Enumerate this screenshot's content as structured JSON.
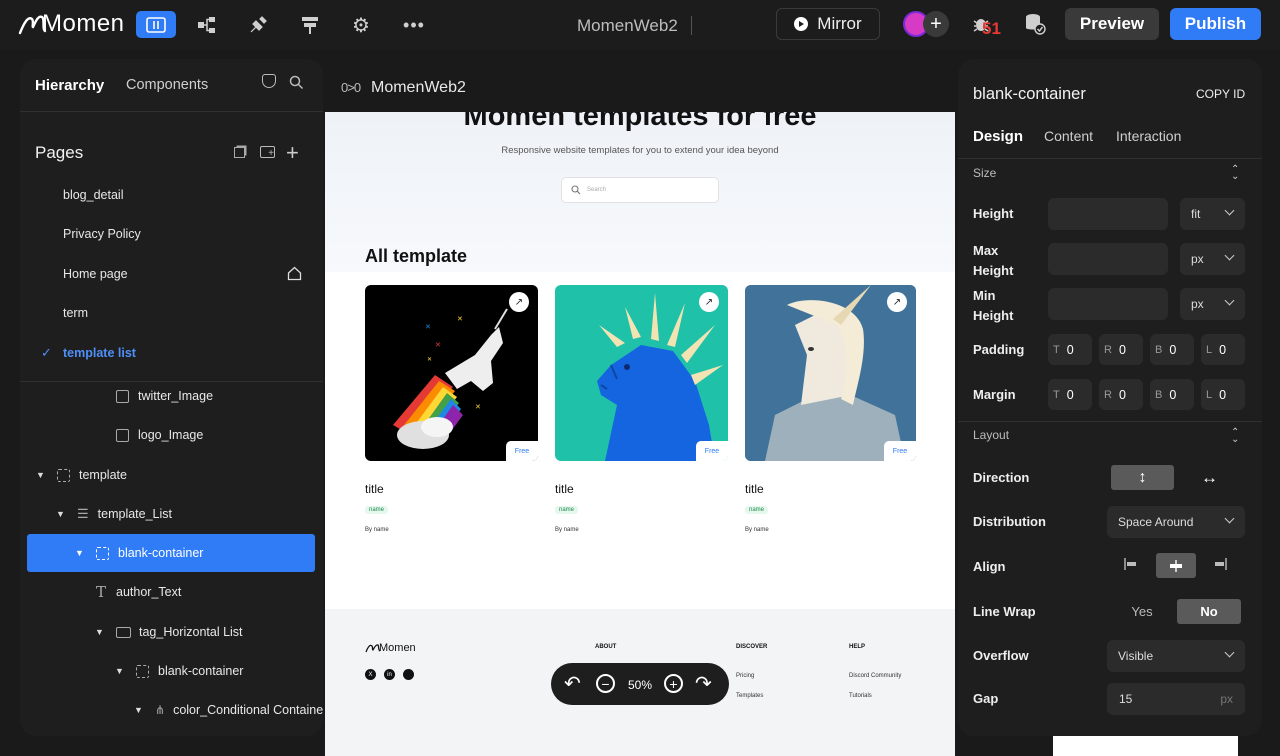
{
  "topbar": {
    "brand": "Momen",
    "project_title": "MomenWeb2",
    "mirror_label": "Mirror",
    "notification_count": "51",
    "preview_label": "Preview",
    "publish_label": "Publish",
    "accent": "#2f7cf6"
  },
  "left": {
    "tabs": [
      "Hierarchy",
      "Components"
    ],
    "pages_title": "Pages",
    "pages": [
      "blog_detail",
      "Privacy Policy",
      "Home page",
      "term",
      "template list"
    ],
    "active_page": "template list",
    "tree": [
      {
        "label": "twitter_Image",
        "icon": "image-icon",
        "indent": 3
      },
      {
        "label": "logo_Image",
        "icon": "image-icon",
        "indent": 3
      },
      {
        "label": "template",
        "icon": "container-icon",
        "indent": 1,
        "expanded": true
      },
      {
        "label": "template_List",
        "icon": "list-icon",
        "indent": 2,
        "expanded": true
      },
      {
        "label": "blank-container",
        "icon": "container-icon",
        "indent": 3,
        "expanded": true,
        "selected": true
      },
      {
        "label": "author_Text",
        "icon": "text-icon",
        "indent": 3
      },
      {
        "label": "tag_Horizontal List",
        "icon": "horizontal-list-icon",
        "indent": 4,
        "expanded": true
      },
      {
        "label": "blank-container",
        "icon": "container-icon",
        "indent": 5,
        "expanded": true
      },
      {
        "label": "color_Conditional Containe",
        "icon": "conditional-icon",
        "indent": 6,
        "expanded": true
      }
    ]
  },
  "canvas": {
    "breadcrumb": "MomenWeb2",
    "hero_title": "Momen templates for free",
    "hero_subtitle": "Responsive website templates for you to extend your idea beyond",
    "search_placeholder": "Search",
    "section_title": "All template",
    "cards": [
      {
        "title": "title",
        "tag": "name",
        "by": "By name",
        "badge": "Free"
      },
      {
        "title": "title",
        "tag": "name",
        "by": "By name",
        "badge": "Free"
      },
      {
        "title": "title",
        "tag": "name",
        "by": "By name",
        "badge": "Free"
      }
    ],
    "footer": {
      "brand": "Momen",
      "columns": [
        {
          "heading": "ABOUT",
          "links": []
        },
        {
          "heading": "DISCOVER",
          "links": [
            "Pricing",
            "Templates"
          ]
        },
        {
          "heading": "HELP",
          "links": [
            "Discord Community",
            "Tutorials"
          ]
        }
      ]
    },
    "zoom": "50%"
  },
  "right": {
    "element_name": "blank-container",
    "copy_id_label": "COPY ID",
    "tabs": [
      "Design",
      "Content",
      "Interaction"
    ],
    "size_section": "Size",
    "height_label": "Height",
    "height_unit": "fit",
    "max_height_label": "Max Height",
    "max_height_unit": "px",
    "min_height_label": "Min Height",
    "min_height_unit": "px",
    "padding_label": "Padding",
    "padding": {
      "T": "0",
      "R": "0",
      "B": "0",
      "L": "0"
    },
    "margin_label": "Margin",
    "margin": {
      "T": "0",
      "R": "0",
      "B": "0",
      "L": "0"
    },
    "layout_section": "Layout",
    "direction_label": "Direction",
    "distribution_label": "Distribution",
    "distribution_value": "Space Around",
    "align_label": "Align",
    "line_wrap_label": "Line Wrap",
    "line_wrap_yes": "Yes",
    "line_wrap_no": "No",
    "overflow_label": "Overflow",
    "overflow_value": "Visible",
    "gap_label": "Gap",
    "gap_value": "15",
    "gap_unit": "px"
  }
}
